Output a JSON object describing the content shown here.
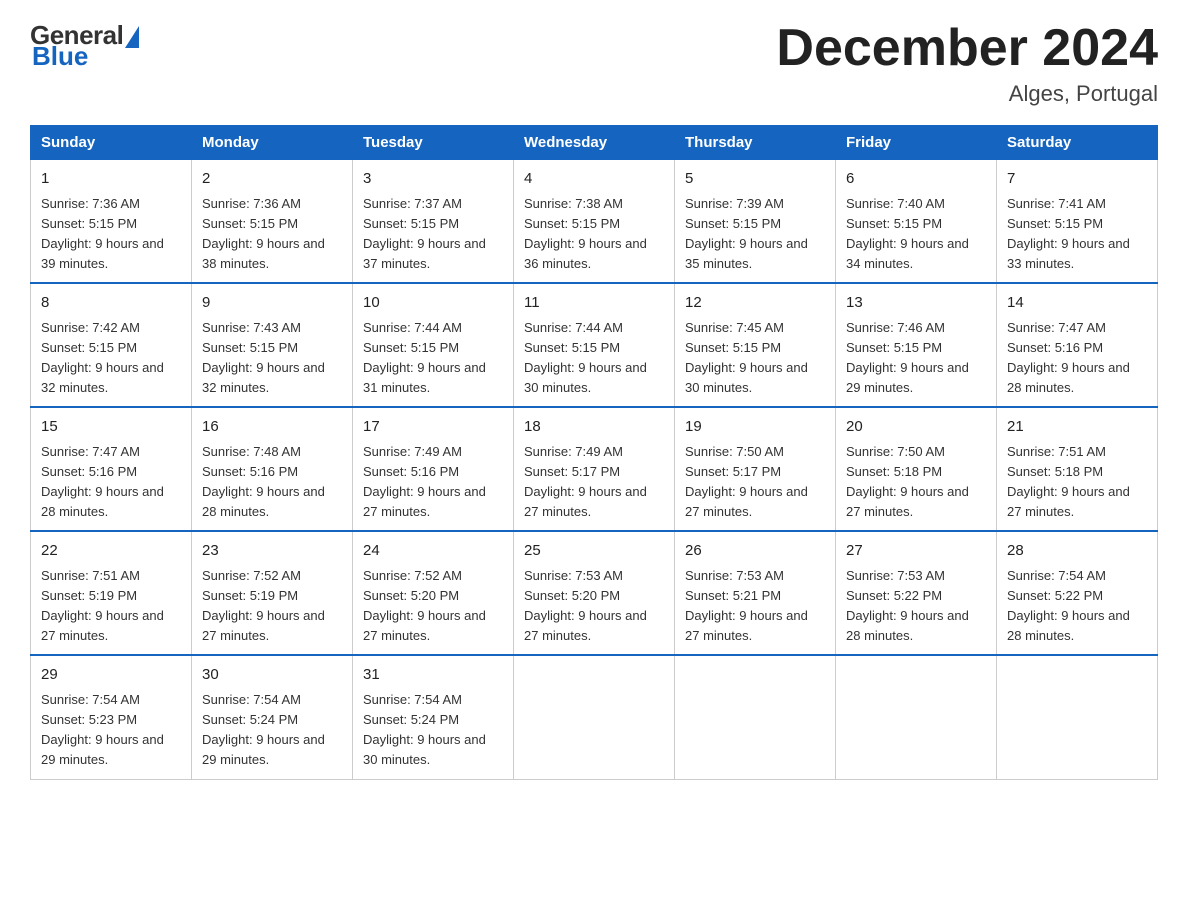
{
  "header": {
    "logo_general": "General",
    "logo_blue": "Blue",
    "month_title": "December 2024",
    "location": "Alges, Portugal"
  },
  "weekdays": [
    "Sunday",
    "Monday",
    "Tuesday",
    "Wednesday",
    "Thursday",
    "Friday",
    "Saturday"
  ],
  "weeks": [
    [
      {
        "day": "1",
        "sunrise": "7:36 AM",
        "sunset": "5:15 PM",
        "daylight": "9 hours and 39 minutes."
      },
      {
        "day": "2",
        "sunrise": "7:36 AM",
        "sunset": "5:15 PM",
        "daylight": "9 hours and 38 minutes."
      },
      {
        "day": "3",
        "sunrise": "7:37 AM",
        "sunset": "5:15 PM",
        "daylight": "9 hours and 37 minutes."
      },
      {
        "day": "4",
        "sunrise": "7:38 AM",
        "sunset": "5:15 PM",
        "daylight": "9 hours and 36 minutes."
      },
      {
        "day": "5",
        "sunrise": "7:39 AM",
        "sunset": "5:15 PM",
        "daylight": "9 hours and 35 minutes."
      },
      {
        "day": "6",
        "sunrise": "7:40 AM",
        "sunset": "5:15 PM",
        "daylight": "9 hours and 34 minutes."
      },
      {
        "day": "7",
        "sunrise": "7:41 AM",
        "sunset": "5:15 PM",
        "daylight": "9 hours and 33 minutes."
      }
    ],
    [
      {
        "day": "8",
        "sunrise": "7:42 AM",
        "sunset": "5:15 PM",
        "daylight": "9 hours and 32 minutes."
      },
      {
        "day": "9",
        "sunrise": "7:43 AM",
        "sunset": "5:15 PM",
        "daylight": "9 hours and 32 minutes."
      },
      {
        "day": "10",
        "sunrise": "7:44 AM",
        "sunset": "5:15 PM",
        "daylight": "9 hours and 31 minutes."
      },
      {
        "day": "11",
        "sunrise": "7:44 AM",
        "sunset": "5:15 PM",
        "daylight": "9 hours and 30 minutes."
      },
      {
        "day": "12",
        "sunrise": "7:45 AM",
        "sunset": "5:15 PM",
        "daylight": "9 hours and 30 minutes."
      },
      {
        "day": "13",
        "sunrise": "7:46 AM",
        "sunset": "5:15 PM",
        "daylight": "9 hours and 29 minutes."
      },
      {
        "day": "14",
        "sunrise": "7:47 AM",
        "sunset": "5:16 PM",
        "daylight": "9 hours and 28 minutes."
      }
    ],
    [
      {
        "day": "15",
        "sunrise": "7:47 AM",
        "sunset": "5:16 PM",
        "daylight": "9 hours and 28 minutes."
      },
      {
        "day": "16",
        "sunrise": "7:48 AM",
        "sunset": "5:16 PM",
        "daylight": "9 hours and 28 minutes."
      },
      {
        "day": "17",
        "sunrise": "7:49 AM",
        "sunset": "5:16 PM",
        "daylight": "9 hours and 27 minutes."
      },
      {
        "day": "18",
        "sunrise": "7:49 AM",
        "sunset": "5:17 PM",
        "daylight": "9 hours and 27 minutes."
      },
      {
        "day": "19",
        "sunrise": "7:50 AM",
        "sunset": "5:17 PM",
        "daylight": "9 hours and 27 minutes."
      },
      {
        "day": "20",
        "sunrise": "7:50 AM",
        "sunset": "5:18 PM",
        "daylight": "9 hours and 27 minutes."
      },
      {
        "day": "21",
        "sunrise": "7:51 AM",
        "sunset": "5:18 PM",
        "daylight": "9 hours and 27 minutes."
      }
    ],
    [
      {
        "day": "22",
        "sunrise": "7:51 AM",
        "sunset": "5:19 PM",
        "daylight": "9 hours and 27 minutes."
      },
      {
        "day": "23",
        "sunrise": "7:52 AM",
        "sunset": "5:19 PM",
        "daylight": "9 hours and 27 minutes."
      },
      {
        "day": "24",
        "sunrise": "7:52 AM",
        "sunset": "5:20 PM",
        "daylight": "9 hours and 27 minutes."
      },
      {
        "day": "25",
        "sunrise": "7:53 AM",
        "sunset": "5:20 PM",
        "daylight": "9 hours and 27 minutes."
      },
      {
        "day": "26",
        "sunrise": "7:53 AM",
        "sunset": "5:21 PM",
        "daylight": "9 hours and 27 minutes."
      },
      {
        "day": "27",
        "sunrise": "7:53 AM",
        "sunset": "5:22 PM",
        "daylight": "9 hours and 28 minutes."
      },
      {
        "day": "28",
        "sunrise": "7:54 AM",
        "sunset": "5:22 PM",
        "daylight": "9 hours and 28 minutes."
      }
    ],
    [
      {
        "day": "29",
        "sunrise": "7:54 AM",
        "sunset": "5:23 PM",
        "daylight": "9 hours and 29 minutes."
      },
      {
        "day": "30",
        "sunrise": "7:54 AM",
        "sunset": "5:24 PM",
        "daylight": "9 hours and 29 minutes."
      },
      {
        "day": "31",
        "sunrise": "7:54 AM",
        "sunset": "5:24 PM",
        "daylight": "9 hours and 30 minutes."
      },
      {
        "day": "",
        "sunrise": "",
        "sunset": "",
        "daylight": ""
      },
      {
        "day": "",
        "sunrise": "",
        "sunset": "",
        "daylight": ""
      },
      {
        "day": "",
        "sunrise": "",
        "sunset": "",
        "daylight": ""
      },
      {
        "day": "",
        "sunrise": "",
        "sunset": "",
        "daylight": ""
      }
    ]
  ]
}
